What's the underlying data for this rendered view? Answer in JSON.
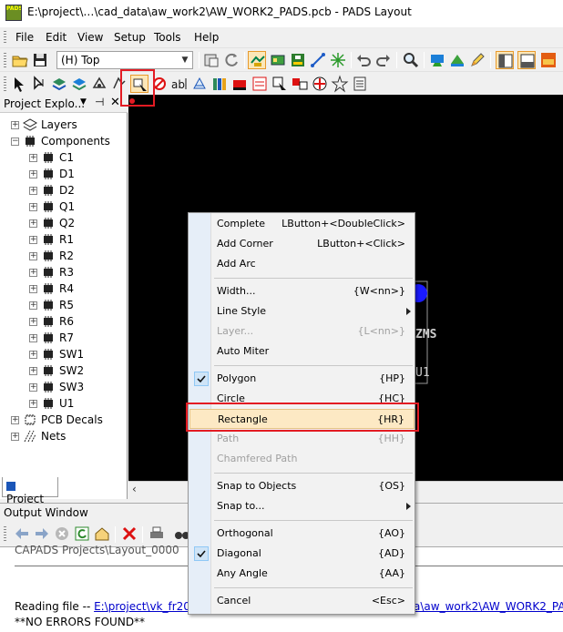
{
  "window": {
    "title": "E:\\project\\…\\cad_data\\aw_work2\\AW_WORK2_PADS.pcb - PADS Layout",
    "logo_text": "PADS"
  },
  "menubar": {
    "items": [
      "File",
      "Edit",
      "View",
      "Setup",
      "Tools",
      "Help"
    ]
  },
  "toolbar": {
    "layer_value": "(H) Top"
  },
  "explorer": {
    "title": "Project Explo...",
    "tab_label": "Project",
    "nodes": [
      {
        "label": "Layers",
        "level": 0,
        "expander": "+",
        "icon": "layers-icon"
      },
      {
        "label": "Components",
        "level": 0,
        "expander": "-",
        "icon": "component-icon"
      },
      {
        "label": "C1",
        "level": 1,
        "expander": "+",
        "icon": "component-icon"
      },
      {
        "label": "D1",
        "level": 1,
        "expander": "+",
        "icon": "component-icon"
      },
      {
        "label": "D2",
        "level": 1,
        "expander": "+",
        "icon": "component-icon"
      },
      {
        "label": "Q1",
        "level": 1,
        "expander": "+",
        "icon": "component-icon"
      },
      {
        "label": "Q2",
        "level": 1,
        "expander": "+",
        "icon": "component-icon"
      },
      {
        "label": "R1",
        "level": 1,
        "expander": "+",
        "icon": "component-icon"
      },
      {
        "label": "R2",
        "level": 1,
        "expander": "+",
        "icon": "component-icon"
      },
      {
        "label": "R3",
        "level": 1,
        "expander": "+",
        "icon": "component-icon"
      },
      {
        "label": "R4",
        "level": 1,
        "expander": "+",
        "icon": "component-icon"
      },
      {
        "label": "R5",
        "level": 1,
        "expander": "+",
        "icon": "component-icon"
      },
      {
        "label": "R6",
        "level": 1,
        "expander": "+",
        "icon": "component-icon"
      },
      {
        "label": "R7",
        "level": 1,
        "expander": "+",
        "icon": "component-icon"
      },
      {
        "label": "SW1",
        "level": 1,
        "expander": "+",
        "icon": "component-icon"
      },
      {
        "label": "SW2",
        "level": 1,
        "expander": "+",
        "icon": "component-icon"
      },
      {
        "label": "SW3",
        "level": 1,
        "expander": "+",
        "icon": "component-icon"
      },
      {
        "label": "U1",
        "level": 1,
        "expander": "+",
        "icon": "component-icon"
      },
      {
        "label": "PCB Decals",
        "level": 0,
        "expander": "+",
        "icon": "decal-icon"
      },
      {
        "label": "Nets",
        "level": 0,
        "expander": "+",
        "icon": "nets-icon"
      }
    ]
  },
  "canvas": {
    "label_main": "ZMS",
    "label_ref": "U1"
  },
  "output": {
    "title": "Output Window",
    "line1": "CAPADS Projects\\Layout_0000",
    "line2_prefix": "Reading file -- ",
    "line2_link": "E:\\project\\vk_fr202",
    "line2_tail": "a\\aw_work2\\AW_WORK2_PA",
    "line3": "**NO ERRORS FOUND**"
  },
  "context_menu": {
    "items": [
      {
        "label": "Complete",
        "shortcut": "LButton+<DoubleClick>"
      },
      {
        "label": "Add Corner",
        "shortcut": "LButton+<Click>"
      },
      {
        "label": "Add Arc",
        "shortcut": ""
      },
      {
        "label": "Width...",
        "shortcut": "{W<nn>}"
      },
      {
        "label": "Line Style",
        "shortcut": ""
      },
      {
        "label": "Layer...",
        "shortcut": "{L<nn>}"
      },
      {
        "label": "Auto Miter",
        "shortcut": ""
      },
      {
        "label": "Polygon",
        "shortcut": "{HP}"
      },
      {
        "label": "Circle",
        "shortcut": "{HC}"
      },
      {
        "label": "Rectangle",
        "shortcut": "{HR}"
      },
      {
        "label": "Path",
        "shortcut": "{HH}"
      },
      {
        "label": "Chamfered Path",
        "shortcut": ""
      },
      {
        "label": "Snap to Objects",
        "shortcut": "{OS}"
      },
      {
        "label": "Snap to...",
        "shortcut": ""
      },
      {
        "label": "Orthogonal",
        "shortcut": "{AO}"
      },
      {
        "label": "Diagonal",
        "shortcut": "{AD}"
      },
      {
        "label": "Any Angle",
        "shortcut": "{AA}"
      },
      {
        "label": "Cancel",
        "shortcut": "<Esc>"
      }
    ]
  },
  "colors": {
    "highlight_border": "#e31b23",
    "canvas_bg": "#000000",
    "component_blue": "#1a1aff"
  }
}
